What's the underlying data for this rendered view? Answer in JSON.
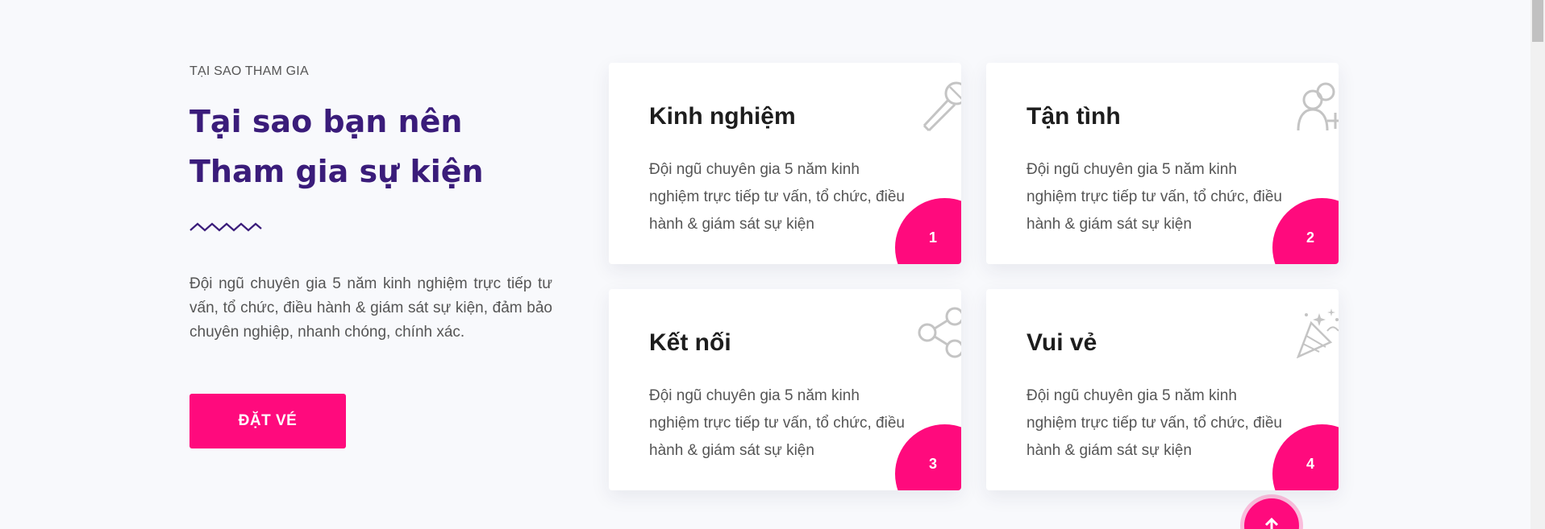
{
  "section": {
    "eyebrow": "TẠI SAO THAM GIA",
    "headline_line1": "Tại sao bạn nên",
    "headline_line2": "Tham gia sự kiện",
    "description": "Đội ngũ chuyên gia 5 năm kinh nghiệm trực tiếp tư vấn, tổ chức, điều hành & giám sát sự kiện, đảm bảo chuyên nghiệp, nhanh chóng, chính xác.",
    "cta_label": "ĐẶT VÉ"
  },
  "cards": [
    {
      "title": "Kinh nghiệm",
      "text": "Đội ngũ chuyên gia 5 năm kinh nghiệm trực tiếp tư vấn, tổ chức, điều hành & giám sát sự kiện",
      "number": "1",
      "icon": "microphone-icon"
    },
    {
      "title": "Tận tình",
      "text": "Đội ngũ chuyên gia 5 năm kinh nghiệm trực tiếp tư vấn, tổ chức, điều hành & giám sát sự kiện",
      "number": "2",
      "icon": "users-icon"
    },
    {
      "title": "Kết nối",
      "text": "Đội ngũ chuyên gia 5 năm kinh nghiệm trực tiếp tư vấn, tổ chức, điều hành & giám sát sự kiện",
      "number": "3",
      "icon": "share-icon"
    },
    {
      "title": "Vui vẻ",
      "text": "Đội ngũ chuyên gia 5 năm kinh nghiệm trực tiếp tư vấn, tổ chức, điều hành & giám sát sự kiện",
      "number": "4",
      "icon": "party-popper-icon"
    }
  ],
  "colors": {
    "accent": "#ff0a7d",
    "heading": "#3a1c7a",
    "background": "#f8f9fc"
  }
}
